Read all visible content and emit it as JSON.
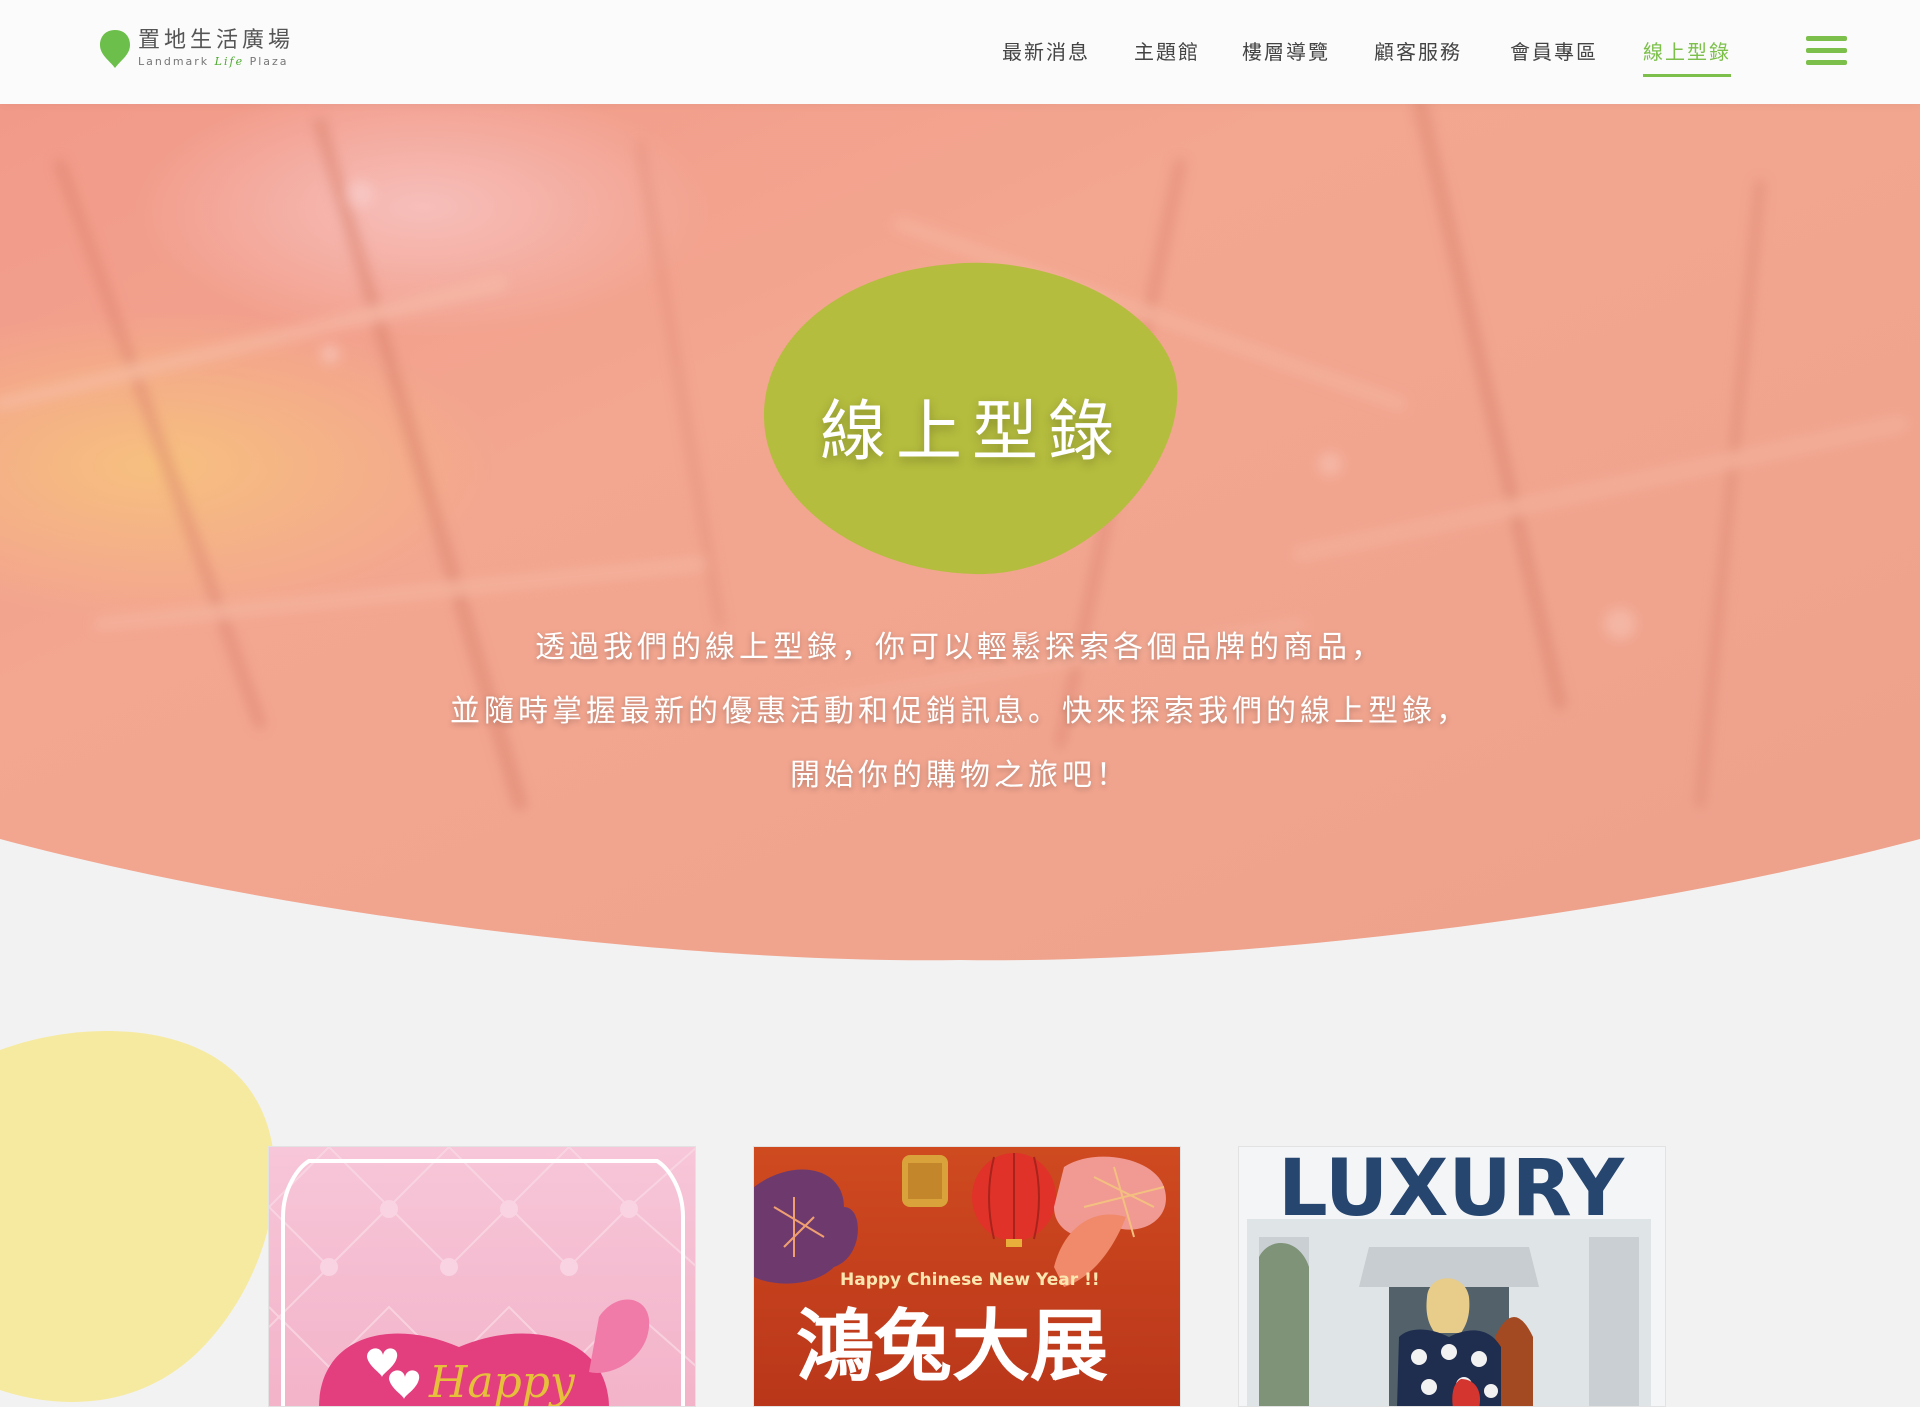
{
  "logo": {
    "name_zh": "置地生活廣場",
    "name_en_prefix": "Landmark",
    "name_en_life": "Life",
    "name_en_suffix": "Plaza"
  },
  "nav": {
    "items": [
      {
        "label": "最新消息",
        "active": false
      },
      {
        "label": "主題館",
        "active": false
      },
      {
        "label": "樓層導覽",
        "active": false
      },
      {
        "label": "顧客服務",
        "active": false
      },
      {
        "label": "會員專區",
        "active": false
      },
      {
        "label": "線上型錄",
        "active": true
      }
    ],
    "menu_icon": "hamburger-icon"
  },
  "hero": {
    "title": "線上型錄",
    "description_lines": [
      "透過我們的線上型錄，你可以輕鬆探索各個品牌的商品，",
      "並隨時掌握最新的優惠活動和促銷訊息。快來探索我們的線上型錄，",
      "開始你的購物之旅吧！"
    ]
  },
  "catalogs": [
    {
      "image_text": "Happy"
    },
    {
      "image_text_en": "Happy Chinese New Year !!",
      "image_text_zh": "鴻兔大展"
    },
    {
      "image_text": "LUXURY"
    }
  ],
  "colors": {
    "accent_green": "#7cc04b",
    "blob_green": "#b5bd3e",
    "hero_pink": "#f0a08c",
    "yellow_blob": "#f6eaa0",
    "background": "#f2f2f2"
  }
}
